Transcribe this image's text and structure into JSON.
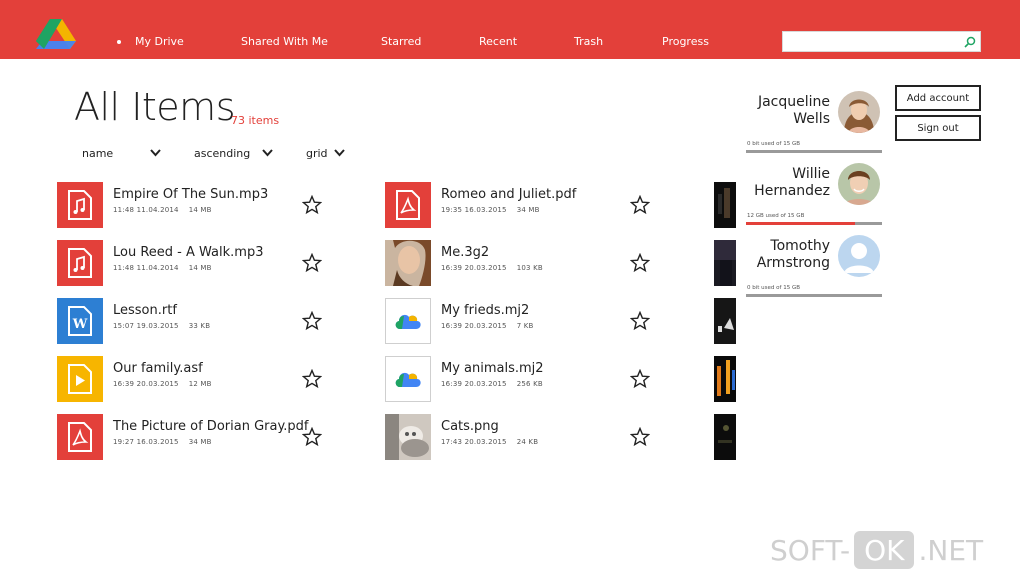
{
  "nav": {
    "items": [
      "My Drive",
      "Shared With Me",
      "Starred",
      "Recent",
      "Trash",
      "Progress"
    ],
    "search_placeholder": ""
  },
  "header": {
    "title": "All Items",
    "count": "73 items"
  },
  "sort": {
    "field": "name",
    "order": "ascending",
    "view": "grid"
  },
  "files": [
    {
      "name": "Empire Of The Sun.mp3",
      "time": "11:48 11.04.2014",
      "size": "14 MB",
      "icon": "music-file-icon",
      "tile": "red"
    },
    {
      "name": "Lou Reed - A Walk.mp3",
      "time": "11:48 11.04.2014",
      "size": "14 MB",
      "icon": "music-file-icon",
      "tile": "red"
    },
    {
      "name": "Lesson.rtf",
      "time": "15:07 19.03.2015",
      "size": "33 KB",
      "icon": "word-document-icon",
      "tile": "blue"
    },
    {
      "name": "Our family.asf",
      "time": "16:39 20.03.2015",
      "size": "12 MB",
      "icon": "video-file-icon",
      "tile": "yellow"
    },
    {
      "name": "The Picture of Dorian Gray.pdf",
      "time": "19:27 16.03.2015",
      "size": "34 MB",
      "icon": "pdf-file-icon",
      "tile": "red"
    },
    {
      "name": "Romeo and Juliet.pdf",
      "time": "19:35 16.03.2015",
      "size": "34 MB",
      "icon": "pdf-file-icon",
      "tile": "red"
    },
    {
      "name": "Me.3g2",
      "time": "16:39 20.03.2015",
      "size": "103 KB",
      "icon": "photo-thumbnail-woman",
      "tile": "photo-woman"
    },
    {
      "name": "My frieds.mj2",
      "time": "16:39 20.03.2015",
      "size": "7 KB",
      "icon": "google-drive-icon",
      "tile": "drive"
    },
    {
      "name": "My animals.mj2",
      "time": "16:39 20.03.2015",
      "size": "256 KB",
      "icon": "google-drive-icon",
      "tile": "drive"
    },
    {
      "name": "Cats.png",
      "time": "17:43 20.03.2015",
      "size": "24 KB",
      "icon": "photo-thumbnail-cats",
      "tile": "photo-cats"
    }
  ],
  "accounts": [
    {
      "first": "Jacqueline",
      "last": "Wells",
      "usage": "0 bit used of 15 GB",
      "used_fraction": 0.0
    },
    {
      "first": "Willie",
      "last": "Hernandez",
      "usage": "12 GB used of 15 GB",
      "used_fraction": 0.8
    },
    {
      "first": "Tomothy",
      "last": "Armstrong",
      "usage": "0 bit used of 15 GB",
      "used_fraction": 0.0
    }
  ],
  "buttons": {
    "add_account": "Add account",
    "sign_out": "Sign out"
  },
  "watermark": {
    "left": "SOFT-",
    "box": "OK",
    "right": ".NET"
  },
  "colors": {
    "accent": "#e3403a",
    "blue": "#2d7fd3",
    "yellow": "#f7b500"
  }
}
